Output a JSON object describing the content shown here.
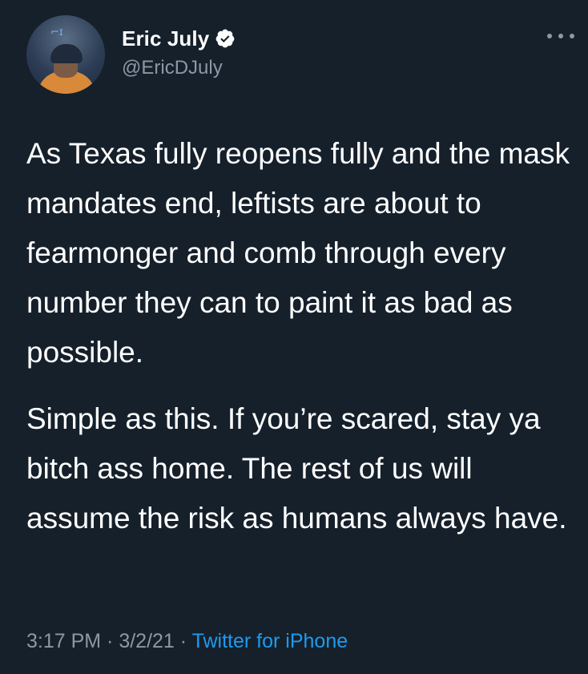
{
  "tweet": {
    "author": {
      "name": "Eric July",
      "handle": "@EricDJuly",
      "verified": true,
      "avatar_icon": "profile-photo"
    },
    "more_icon": "more-horizontal-icon",
    "paragraphs": [
      "As Texas fully reopens fully and the mask mandates end, leftists are about to fearmonger and comb through every number they can to paint it as bad as possible.",
      "Simple as this. If you’re scared, stay ya bitch ass home. The rest of us will assume the risk as humans always have."
    ],
    "time": "3:17 PM",
    "separator": " · ",
    "date": "3/2/21",
    "source": "Twitter for iPhone"
  },
  "colors": {
    "background": "#15202b",
    "text": "#ffffff",
    "secondary": "#8b98a5",
    "link": "#1d9bf0",
    "verified_badge": "#ffffff"
  }
}
